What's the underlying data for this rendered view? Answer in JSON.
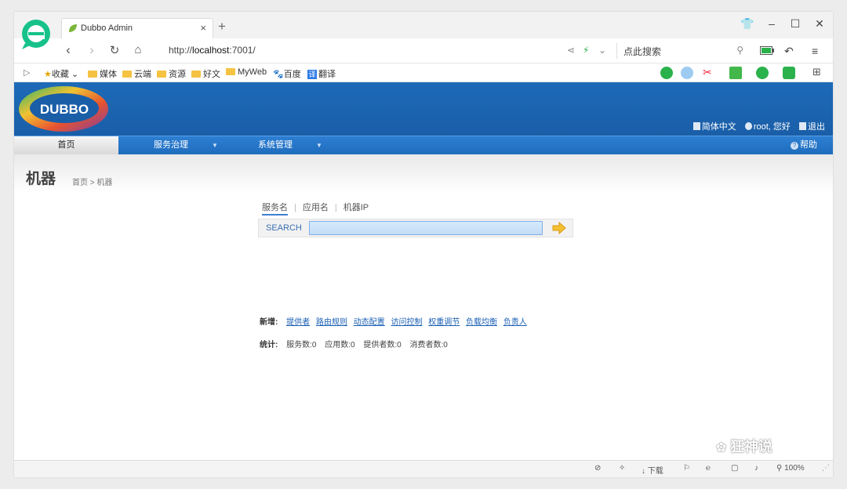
{
  "browser": {
    "tab_title": "Dubbo Admin",
    "tab_close": "×",
    "new_tab": "+",
    "url_prefix": "http://",
    "url_host": "localhost",
    "url_rest": ":7001/",
    "search_placeholder": "点此搜索",
    "window_controls": {
      "minimize": "–",
      "maximize": "☐",
      "close": "✕"
    }
  },
  "bookmarks": [
    {
      "label": "收藏",
      "icon": "star-icon"
    },
    {
      "label": "媒体",
      "icon": "folder-icon"
    },
    {
      "label": "云端",
      "icon": "folder-icon"
    },
    {
      "label": "资源",
      "icon": "folder-icon"
    },
    {
      "label": "好文",
      "icon": "folder-icon"
    },
    {
      "label": "MyWeb",
      "icon": "folder-icon"
    },
    {
      "label": "百度",
      "icon": "baidu-icon"
    },
    {
      "label": "翻译",
      "icon": "translate-icon"
    }
  ],
  "header": {
    "logo_text": "DUBBO",
    "lang": "简体中文",
    "greeting": "root, 您好",
    "logout": "退出"
  },
  "nav": {
    "home": "首页",
    "service": "服务治理",
    "system": "系统管理",
    "help": "帮助"
  },
  "page": {
    "title": "机器",
    "breadcrumb": "首页 > 机器"
  },
  "search": {
    "tabs": [
      "服务名",
      "应用名",
      "机器IP"
    ],
    "label": "SEARCH",
    "value": ""
  },
  "create": {
    "label": "新增:",
    "links": [
      "提供者",
      "路由规则",
      "动态配置",
      "访问控制",
      "权重调节",
      "负载均衡",
      "负责人"
    ]
  },
  "stats": {
    "label": "统计:",
    "items": [
      "服务数:0",
      "应用数:0",
      "提供者数:0",
      "消费者数:0"
    ]
  },
  "statusbar": {
    "download": "下载",
    "zoom": "100%"
  },
  "watermark": "狂神说",
  "colors": {
    "banner": "#1a5ea8",
    "nav": "#2472c4",
    "link": "#1a5fb4",
    "accent": "#f5a623"
  }
}
